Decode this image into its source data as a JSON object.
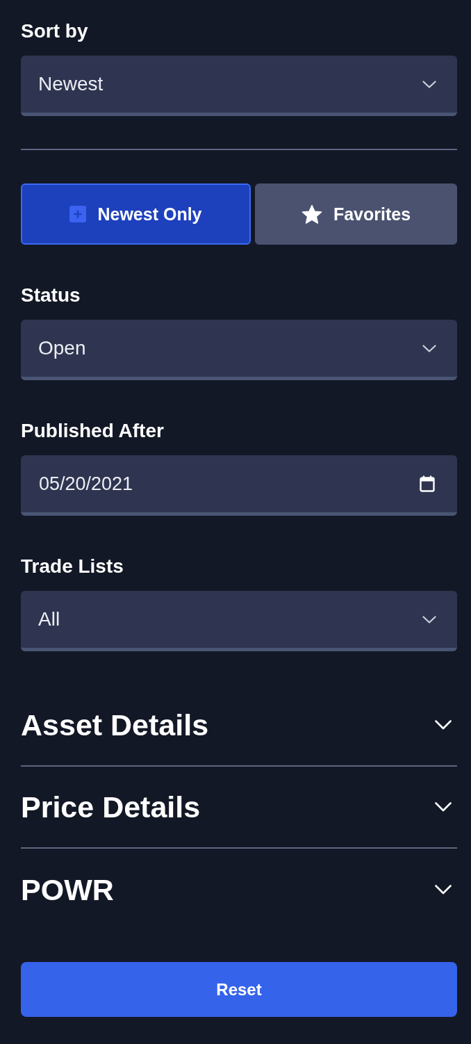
{
  "sort": {
    "label": "Sort by",
    "value": "Newest"
  },
  "toggles": [
    {
      "label": "Newest Only",
      "selected": true
    },
    {
      "label": "Favorites",
      "selected": false
    }
  ],
  "fields": [
    {
      "kind": "select",
      "label": "Status",
      "value": "Open"
    },
    {
      "kind": "date",
      "label": "Published After",
      "value": "05/20/2021"
    },
    {
      "kind": "select",
      "label": "Trade Lists",
      "value": "All"
    }
  ],
  "sections": [
    {
      "title": "Asset Details",
      "expanded": false
    },
    {
      "title": "Price Details",
      "expanded": false
    },
    {
      "title": "POWR",
      "expanded": false
    }
  ],
  "reset_button": {
    "label": "Reset"
  }
}
